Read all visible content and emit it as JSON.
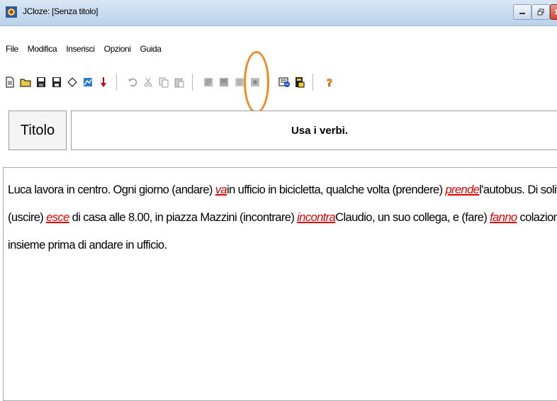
{
  "window": {
    "title": "JCloze: [Senza titolo]"
  },
  "menu": [
    "File",
    "Modifica",
    "Inserisci",
    "Opzioni",
    "Guida"
  ],
  "toolbar": {
    "icons": [
      "new-file-icon",
      "open-folder-icon",
      "save-icon",
      "save-as-icon",
      "diamond-icon",
      "chart-icon",
      "arrow-down-icon",
      "undo-icon",
      "cut-icon",
      "copy-icon",
      "paste-icon",
      "gap-add-icon",
      "gap-remove-icon",
      "gap-list-icon",
      "gap-options-icon",
      "export-web-icon",
      "export-html-icon",
      "help-icon"
    ],
    "highlight_color": "#f28a21"
  },
  "titolo": {
    "label": "Titolo",
    "value": "Usa i verbi."
  },
  "text": {
    "segments": [
      {
        "t": "Luca lavora in centro. Ogni giorno (andare) "
      },
      {
        "gap": "va"
      },
      {
        "t": "in ufficio in bicicletta, qualche volta (prendere) "
      },
      {
        "gap": "prende"
      },
      {
        "t": "l'autobus. Di solito (uscire) "
      },
      {
        "gap": "esce"
      },
      {
        "t": " di casa alle 8.00, in piazza Mazzini (incontrare) "
      },
      {
        "gap": "incontra"
      },
      {
        "t": "Claudio, un suo collega, e (fare) "
      },
      {
        "gap": "fanno"
      },
      {
        "t": " colazione insieme prima di andare in ufficio."
      }
    ],
    "gap_color": "#e00000"
  }
}
